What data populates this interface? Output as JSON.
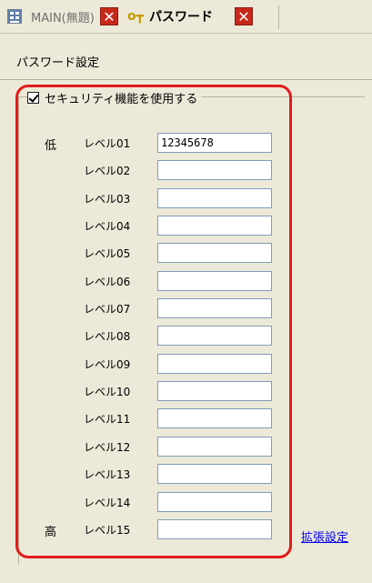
{
  "tabs": [
    {
      "label": "MAIN(無題)",
      "icon": "grid-icon",
      "active": false
    },
    {
      "label": "パスワード",
      "icon": "key-icon",
      "active": true
    }
  ],
  "pane_title": "パスワード設定",
  "security": {
    "checkbox_label": "セキュリティ機能を使用する",
    "checked": true
  },
  "side_labels": {
    "low": "低",
    "high": "高"
  },
  "levels": [
    {
      "label": "レベル01",
      "value": "12345678"
    },
    {
      "label": "レベル02",
      "value": ""
    },
    {
      "label": "レベル03",
      "value": ""
    },
    {
      "label": "レベル04",
      "value": ""
    },
    {
      "label": "レベル05",
      "value": ""
    },
    {
      "label": "レベル06",
      "value": ""
    },
    {
      "label": "レベル07",
      "value": ""
    },
    {
      "label": "レベル08",
      "value": ""
    },
    {
      "label": "レベル09",
      "value": ""
    },
    {
      "label": "レベル10",
      "value": ""
    },
    {
      "label": "レベル11",
      "value": ""
    },
    {
      "label": "レベル12",
      "value": ""
    },
    {
      "label": "レベル13",
      "value": ""
    },
    {
      "label": "レベル14",
      "value": ""
    },
    {
      "label": "レベル15",
      "value": ""
    }
  ],
  "extended_settings_link": "拡張設定",
  "colors": {
    "highlight": "#e31b1b",
    "close_button": "#c8281a",
    "link": "#0000ee"
  }
}
